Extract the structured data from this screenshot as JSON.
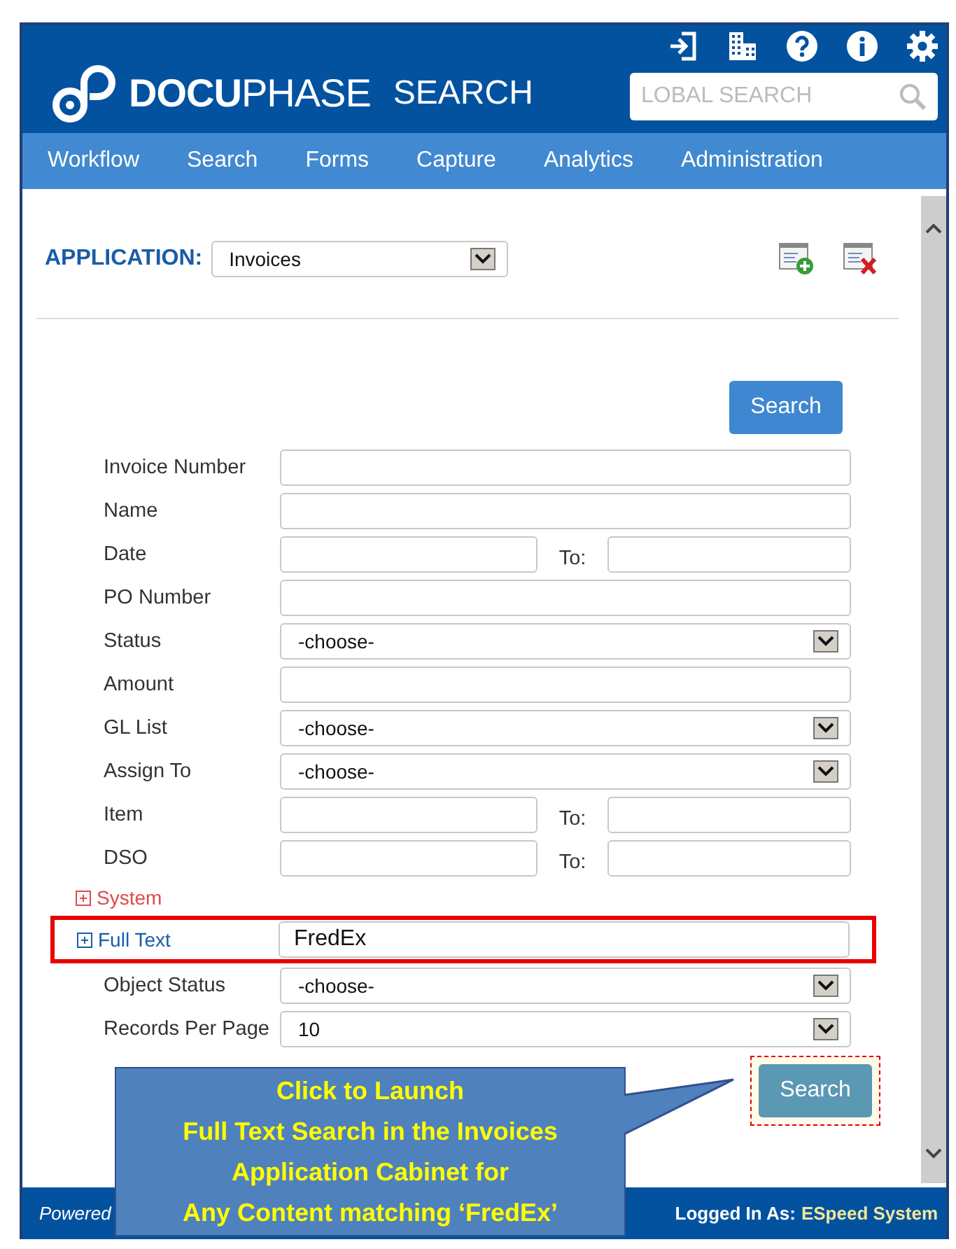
{
  "header": {
    "logo_bold": "DOCU",
    "logo_light": "PHASE",
    "product": "SEARCH",
    "global_search": {
      "placeholder": "LOBAL SEARCH"
    }
  },
  "nav": [
    {
      "label": "Workflow"
    },
    {
      "label": "Search"
    },
    {
      "label": "Forms"
    },
    {
      "label": "Capture"
    },
    {
      "label": "Analytics"
    },
    {
      "label": "Administration"
    }
  ],
  "application": {
    "label": "APPLICATION:",
    "value": "Invoices"
  },
  "search_button_top": "Search",
  "fields": [
    {
      "kind": "text",
      "label": "Invoice Number"
    },
    {
      "kind": "text",
      "label": "Name"
    },
    {
      "kind": "range",
      "label": "Date",
      "to_label": "To:"
    },
    {
      "kind": "text",
      "label": "PO Number"
    },
    {
      "kind": "select",
      "label": "Status",
      "value": "-choose-"
    },
    {
      "kind": "text",
      "label": "Amount"
    },
    {
      "kind": "select",
      "label": "GL List",
      "value": "-choose-"
    },
    {
      "kind": "select",
      "label": "Assign To",
      "value": "-choose-"
    },
    {
      "kind": "range",
      "label": "Item",
      "to_label": "To:"
    },
    {
      "kind": "range",
      "label": "DSO",
      "to_label": "To:"
    }
  ],
  "system_section": {
    "label": "System"
  },
  "full_text": {
    "label": "Full Text",
    "value": "FredEx",
    "highlighted": true
  },
  "fields_after": [
    {
      "kind": "select",
      "label": "Object Status",
      "value": "-choose-"
    },
    {
      "kind": "select",
      "label": "Records Per Page",
      "value": "10"
    }
  ],
  "search_button_bottom": {
    "label": "Search",
    "highlighted": true
  },
  "callout": {
    "lines": [
      "Click to Launch",
      "Full Text Search in the Invoices",
      "Application Cabinet for",
      "Any Content matching ‘FredEx’"
    ]
  },
  "footer": {
    "powered": "Powered",
    "logged_in_label": "Logged In As:",
    "user": "ESpeed System"
  }
}
